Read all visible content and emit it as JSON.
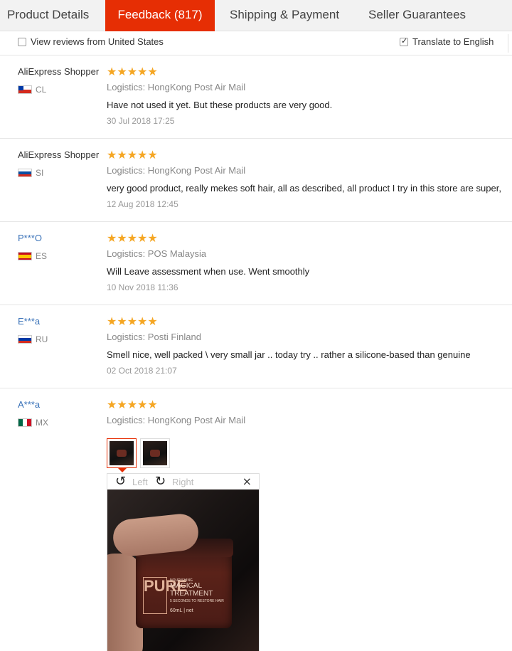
{
  "tabs": [
    {
      "label": "Product Details"
    },
    {
      "label": "Feedback (817)"
    },
    {
      "label": "Shipping & Payment"
    },
    {
      "label": "Seller Guarantees"
    }
  ],
  "filters": {
    "view_us": {
      "label": "View reviews from United States",
      "checked": false
    },
    "translate": {
      "label": "Translate to English",
      "checked": true
    }
  },
  "reviews": [
    {
      "user": "AliExpress Shopper",
      "country": "CL",
      "stars": "★★★★★",
      "rating": 5,
      "logistics": "Logistics: HongKong Post Air Mail",
      "text": "Have not used it yet. But these products are very good.",
      "date": "30 Jul 2018 17:25"
    },
    {
      "user": "AliExpress Shopper",
      "country": "SI",
      "stars": "★★★★★",
      "rating": 5,
      "logistics": "Logistics: HongKong Post Air Mail",
      "text": "very good product, really mekes soft hair, all as described, all product I try in this store are super,",
      "date": "12 Aug 2018 12:45"
    },
    {
      "user": "P***O",
      "country": "ES",
      "stars": "★★★★★",
      "rating": 5,
      "logistics": "Logistics: POS Malaysia",
      "text": "Will Leave assessment when use. Went smoothly",
      "date": "10 Nov 2018 11:36"
    },
    {
      "user": "E***a",
      "country": "RU",
      "stars": "★★★★★",
      "rating": 5,
      "logistics": "Logistics: Posti Finland",
      "text": "Smell nice, well packed \\ very small jar .. today try .. rather a silicone-based than genuine",
      "date": "02 Oct 2018 21:07"
    },
    {
      "user": "A***a",
      "country": "MX",
      "stars": "★★★★★",
      "rating": 5,
      "logistics": "Logistics: HongKong Post Air Mail"
    }
  ],
  "viewer": {
    "rotate_left_icon": "↺",
    "rotate_right_icon": "↻",
    "left_label": "Left",
    "right_label": "Right",
    "close_icon": "×",
    "product_label": {
      "brand": "PURE",
      "line1": "NOURISHING",
      "line2": "MAGICAL",
      "line3": "TREATMENT",
      "line4": "5 SECONDS TO RESTORE HAIR",
      "size": "60mL | net"
    }
  },
  "colors": {
    "accent": "#e62e04",
    "star": "#f5a623",
    "link": "#3b73b9"
  }
}
